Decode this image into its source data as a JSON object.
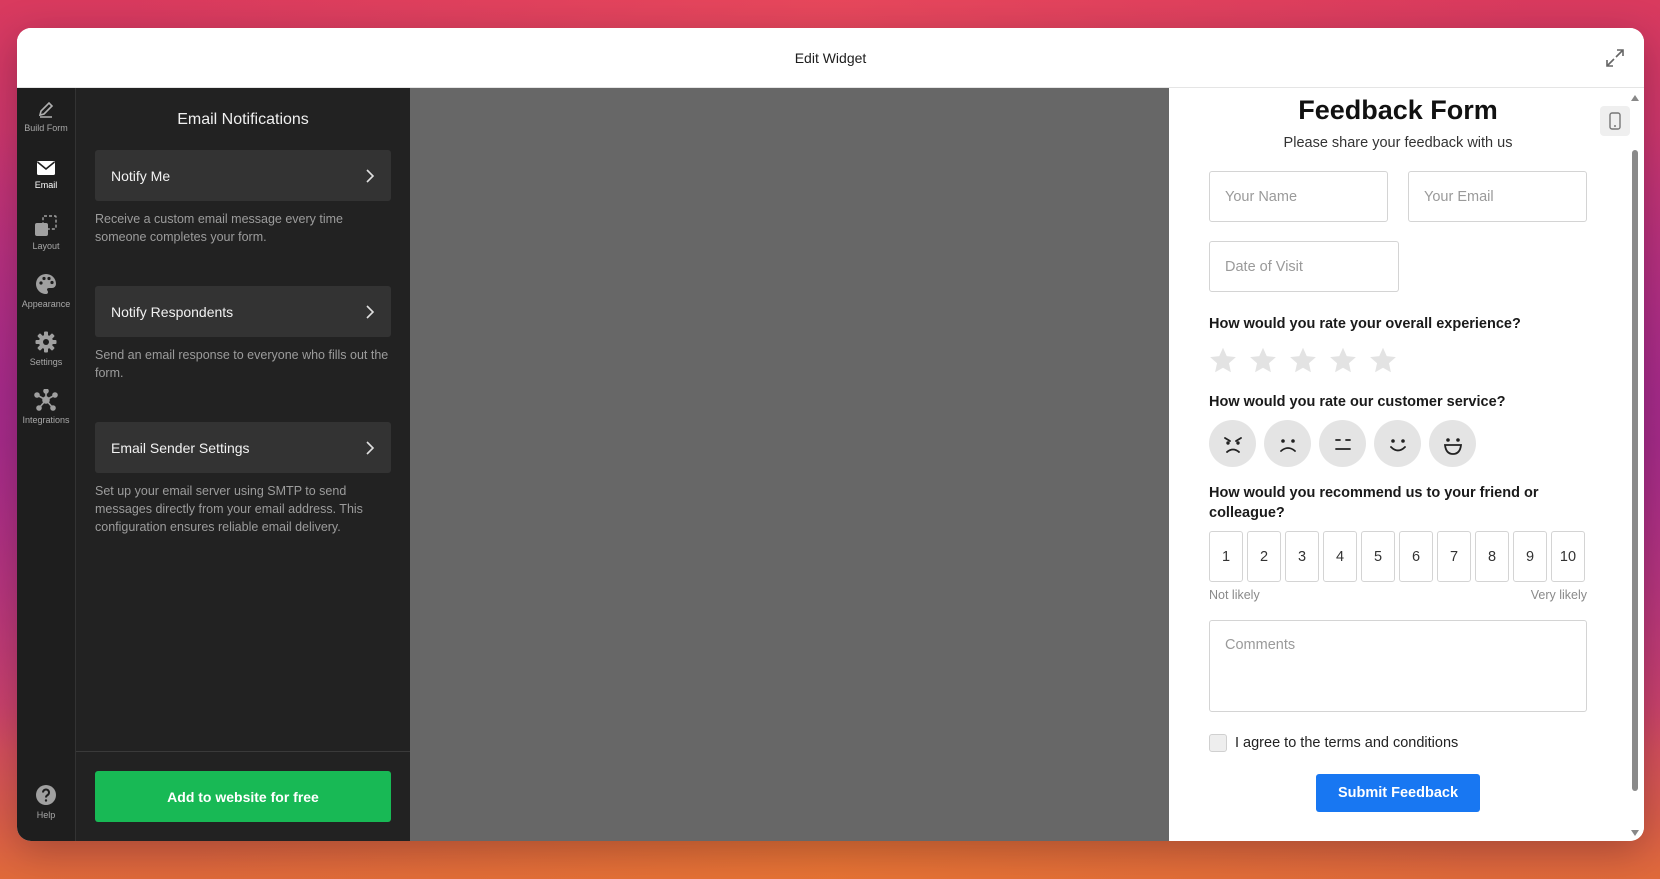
{
  "window": {
    "title": "Edit Widget"
  },
  "rail": {
    "items": [
      {
        "label": "Build Form",
        "icon": "pencil-icon"
      },
      {
        "label": "Email",
        "icon": "envelope-icon",
        "active": true
      },
      {
        "label": "Layout",
        "icon": "layout-icon"
      },
      {
        "label": "Appearance",
        "icon": "palette-icon"
      },
      {
        "label": "Settings",
        "icon": "gear-icon"
      },
      {
        "label": "Integrations",
        "icon": "integrations-icon"
      }
    ],
    "help": {
      "label": "Help",
      "icon": "help-icon"
    }
  },
  "panel": {
    "title": "Email Notifications",
    "cards": [
      {
        "label": "Notify Me",
        "description": "Receive a custom email message every time someone completes your form."
      },
      {
        "label": "Notify Respondents",
        "description": "Send an email response to everyone who fills out the form."
      },
      {
        "label": "Email Sender Settings",
        "description": "Set up your email server using SMTP to send messages directly from your email address. This configuration ensures reliable email delivery."
      }
    ],
    "cta_label": "Add to website for free"
  },
  "form": {
    "title": "Feedback Form",
    "subtitle": "Please share your feedback with us",
    "name_placeholder": "Your Name",
    "email_placeholder": "Your Email",
    "date_placeholder": "Date of Visit",
    "q_experience": "How would you rate your overall experience?",
    "stars_total": 5,
    "stars_selected": 0,
    "q_service": "How would you rate our customer service?",
    "faces": [
      "angry-face-icon",
      "sad-face-icon",
      "neutral-face-icon",
      "smile-face-icon",
      "grin-face-icon"
    ],
    "q_recommend": "How would you recommend us to your friend or colleague?",
    "nps": [
      "1",
      "2",
      "3",
      "4",
      "5",
      "6",
      "7",
      "8",
      "9",
      "10"
    ],
    "nps_low": "Not likely",
    "nps_high": "Very likely",
    "comments_placeholder": "Comments",
    "agree_label": "I agree to the terms and conditions",
    "submit_label": "Submit Feedback"
  },
  "colors": {
    "cta": "#18b955",
    "submit": "#1877f2",
    "rail_bg": "#1e1e1e",
    "panel_bg": "#222222",
    "canvas_bg": "#676767"
  }
}
